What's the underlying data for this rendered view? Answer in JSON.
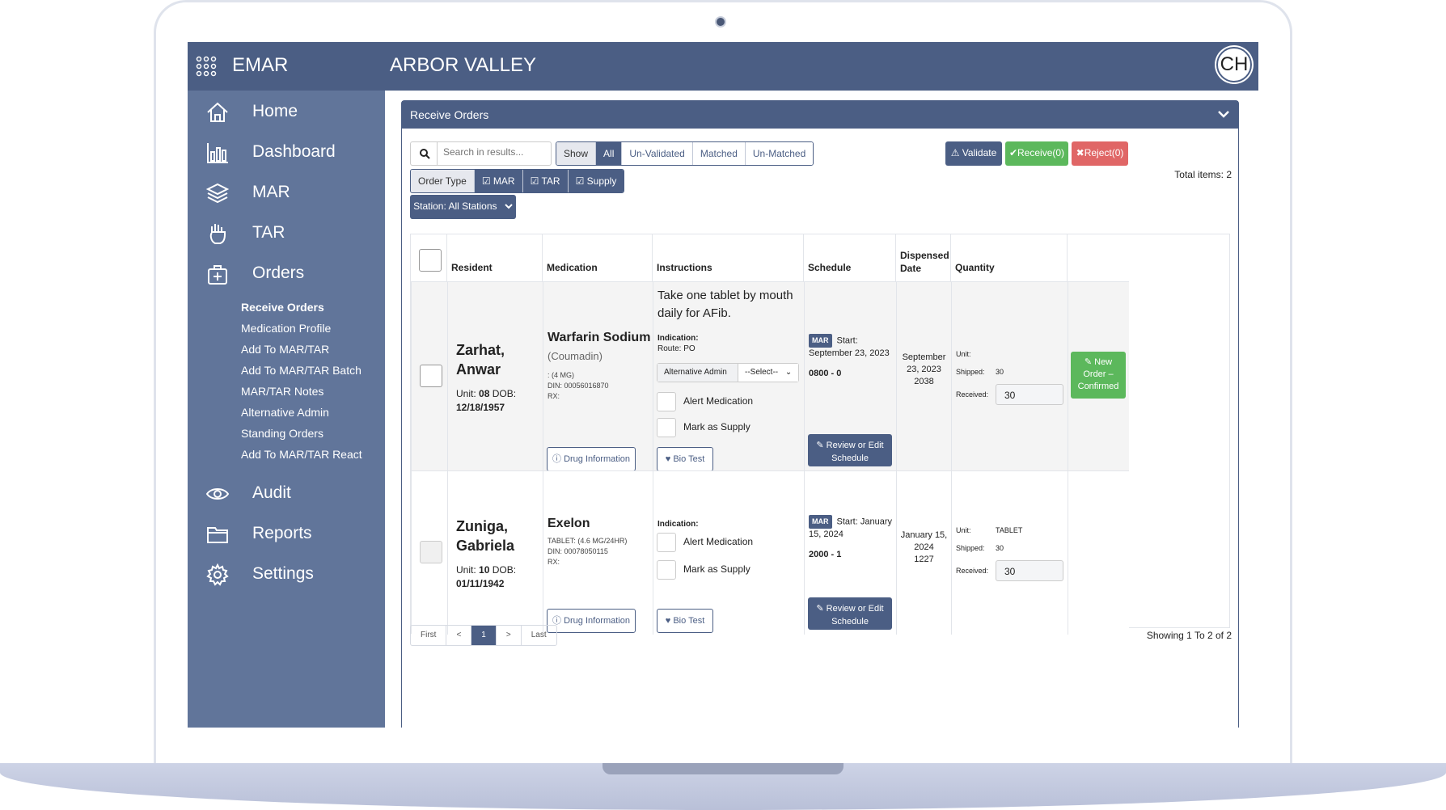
{
  "app": {
    "brand": "EMAR",
    "facility": "ARBOR VALLEY",
    "avatar": "CH"
  },
  "sidebar": {
    "items": [
      {
        "label": "Home",
        "icon": "home-icon"
      },
      {
        "label": "Dashboard",
        "icon": "bar-chart-icon"
      },
      {
        "label": "MAR",
        "icon": "layers-icon"
      },
      {
        "label": "TAR",
        "icon": "hand-icon"
      },
      {
        "label": "Orders",
        "icon": "medical-bag-icon"
      },
      {
        "label": "Audit",
        "icon": "eye-icon"
      },
      {
        "label": "Reports",
        "icon": "folder-icon"
      },
      {
        "label": "Settings",
        "icon": "gear-icon"
      }
    ],
    "sub_items": [
      "Receive Orders",
      "Medication Profile",
      "Add To MAR/TAR",
      "Add To MAR/TAR Batch",
      "MAR/TAR Notes",
      "Alternative Admin",
      "Standing Orders",
      "Add To MAR/TAR React"
    ]
  },
  "panel": {
    "title": "Receive Orders"
  },
  "toolbar": {
    "search_placeholder": "Search in results...",
    "show_label": "Show",
    "show_options": [
      "All",
      "Un-Validated",
      "Matched",
      "Un-Matched"
    ],
    "order_type_label": "Order Type",
    "order_types": [
      "MAR",
      "TAR",
      "Supply"
    ],
    "station": "Station: All Stations",
    "validate": "Validate",
    "receive": "Receive(0)",
    "reject": "Reject(0)",
    "total_items": "Total items: 2"
  },
  "table": {
    "headers": [
      "Resident",
      "Medication",
      "Instructions",
      "Schedule",
      "Dispensed Date",
      "Quantity"
    ],
    "rows": [
      {
        "name1": "Zarhat,",
        "name2": "Anwar",
        "unit_label": "Unit:",
        "unit": "08",
        "dob_label": "DOB:",
        "dob": "12/18/1957",
        "med": "Warfarin Sodium",
        "med_sub": "(Coumadin)",
        "med_detail1": ": (4 MG)",
        "med_detail2": "DIN: 00056016870",
        "med_detail3": "RX:",
        "instr1": "Take one tablet by mouth",
        "instr2": "daily for AFib.",
        "indication": "Indication:",
        "route": "Route: PO",
        "alt_admin": "Alternative Admin",
        "select": "--Select--",
        "alert": "Alert Medication",
        "supply": "Mark as Supply",
        "drug_info": "Drug Information",
        "bio": "Bio Test",
        "sched_badge": "MAR",
        "sched_start": "Start:",
        "sched_date": "September 23, 2023",
        "sched_time": "0800 - 0",
        "review1": "Review or Edit",
        "review2": "Schedule",
        "disp1": "September",
        "disp2": "23, 2023",
        "disp3": "2038",
        "qty_unit_label": "Unit:",
        "qty_unit": "",
        "shipped_label": "Shipped:",
        "shipped": "30",
        "received_label": "Received:",
        "received": "30",
        "action1": "New",
        "action2": "Order –",
        "action3": "Confirmed"
      },
      {
        "name1": "Zuniga,",
        "name2": "Gabriela",
        "unit_label": "Unit:",
        "unit": "10",
        "dob_label": "DOB:",
        "dob": "01/11/1942",
        "med": "Exelon",
        "med_detail1": "TABLET: (4.6 MG/24HR)",
        "med_detail2": "DIN: 00078050115",
        "med_detail3": "RX:",
        "indication": "Indication:",
        "alert": "Alert Medication",
        "supply": "Mark as Supply",
        "drug_info": "Drug Information",
        "bio": "Bio Test",
        "sched_badge": "MAR",
        "sched_start": "Start: January",
        "sched_date": "15, 2024",
        "sched_time": "2000 - 1",
        "review1": "Review or Edit",
        "review2": "Schedule",
        "disp1": "January 15,",
        "disp2": "2024",
        "disp3": "1227",
        "qty_unit_label": "Unit:",
        "qty_unit": "TABLET",
        "shipped_label": "Shipped:",
        "shipped": "30",
        "received_label": "Received:",
        "received": "30"
      }
    ]
  },
  "pager": {
    "first": "First",
    "prev": "<",
    "page": "1",
    "next": ">",
    "last": "Last",
    "showing": "Showing 1 To 2 of 2"
  },
  "colors": {
    "primary": "#4b5e84",
    "sidebar": "#61759a",
    "success": "#5cb85c",
    "danger": "#e06666"
  }
}
